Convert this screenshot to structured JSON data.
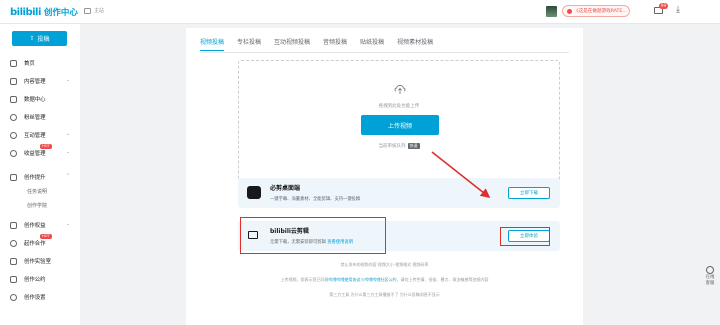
{
  "header": {
    "logo_bili": "bilibili",
    "logo_title": "创作中心",
    "calendar_label": "主站",
    "promo_text": "《这是在做题游戏RATE…",
    "mail_badge": "99",
    "download_glyph": "⤓"
  },
  "sidebar": {
    "upload_label": "投稿",
    "items": [
      {
        "label": "首页",
        "icon": "home-icon"
      },
      {
        "label": "内容管理",
        "icon": "content-icon"
      },
      {
        "label": "数据中心",
        "icon": "data-icon"
      },
      {
        "label": "粉丝管理",
        "icon": "fans-icon"
      },
      {
        "label": "互动管理",
        "icon": "interaction-icon"
      },
      {
        "label": "收益管理",
        "icon": "earnings-icon",
        "badge": "HOT"
      },
      {
        "label": "创作提升",
        "icon": "improve-icon"
      },
      {
        "label": "创作权益",
        "icon": "rights-icon"
      },
      {
        "label": "起作合作",
        "icon": "cooperation-icon",
        "badge": "HOT"
      },
      {
        "label": "创作实验室",
        "icon": "lab-icon"
      },
      {
        "label": "创作公约",
        "icon": "convention-icon"
      },
      {
        "label": "创作设置",
        "icon": "settings-icon"
      }
    ],
    "sub_items": [
      "任务说明",
      "创作学院"
    ]
  },
  "tabs": [
    "视频投稿",
    "专栏投稿",
    "互动视频投稿",
    "音频投稿",
    "贴纸投稿",
    "视频素材投稿"
  ],
  "upload": {
    "hint": "拖拽到此处也能上传",
    "button": "上传视频",
    "footer": "当前审核队列",
    "footer_tag": "快速"
  },
  "promos": [
    {
      "title": "必剪桌面端",
      "desc": "一键字幕、海量素材、全能剪辑、支持一键投稿",
      "link": "",
      "button": "立即下载"
    },
    {
      "title": "bilibili云剪辑",
      "desc": "无需下载，无需安装即可剪辑",
      "link": "查看使用说明",
      "button": "立即体验"
    }
  ],
  "footer": {
    "line1": "禁止发布的视频内容   视频大小   视频格式   视频码率",
    "line2_prefix": "上传视频，即表示您已同意",
    "line2_link1": "哔哩哔哩使用协议",
    "line2_mid": "与",
    "line2_link2": "哔哩哔哩社区公约",
    "line2_suffix": "，请勿上传色情、低俗、暴力、政治敏感等违规内容",
    "line3": "第三方工具   为什么第三方工具播放不了   为什么投稿消息不显示"
  },
  "help": {
    "label": "在线\n客服"
  }
}
